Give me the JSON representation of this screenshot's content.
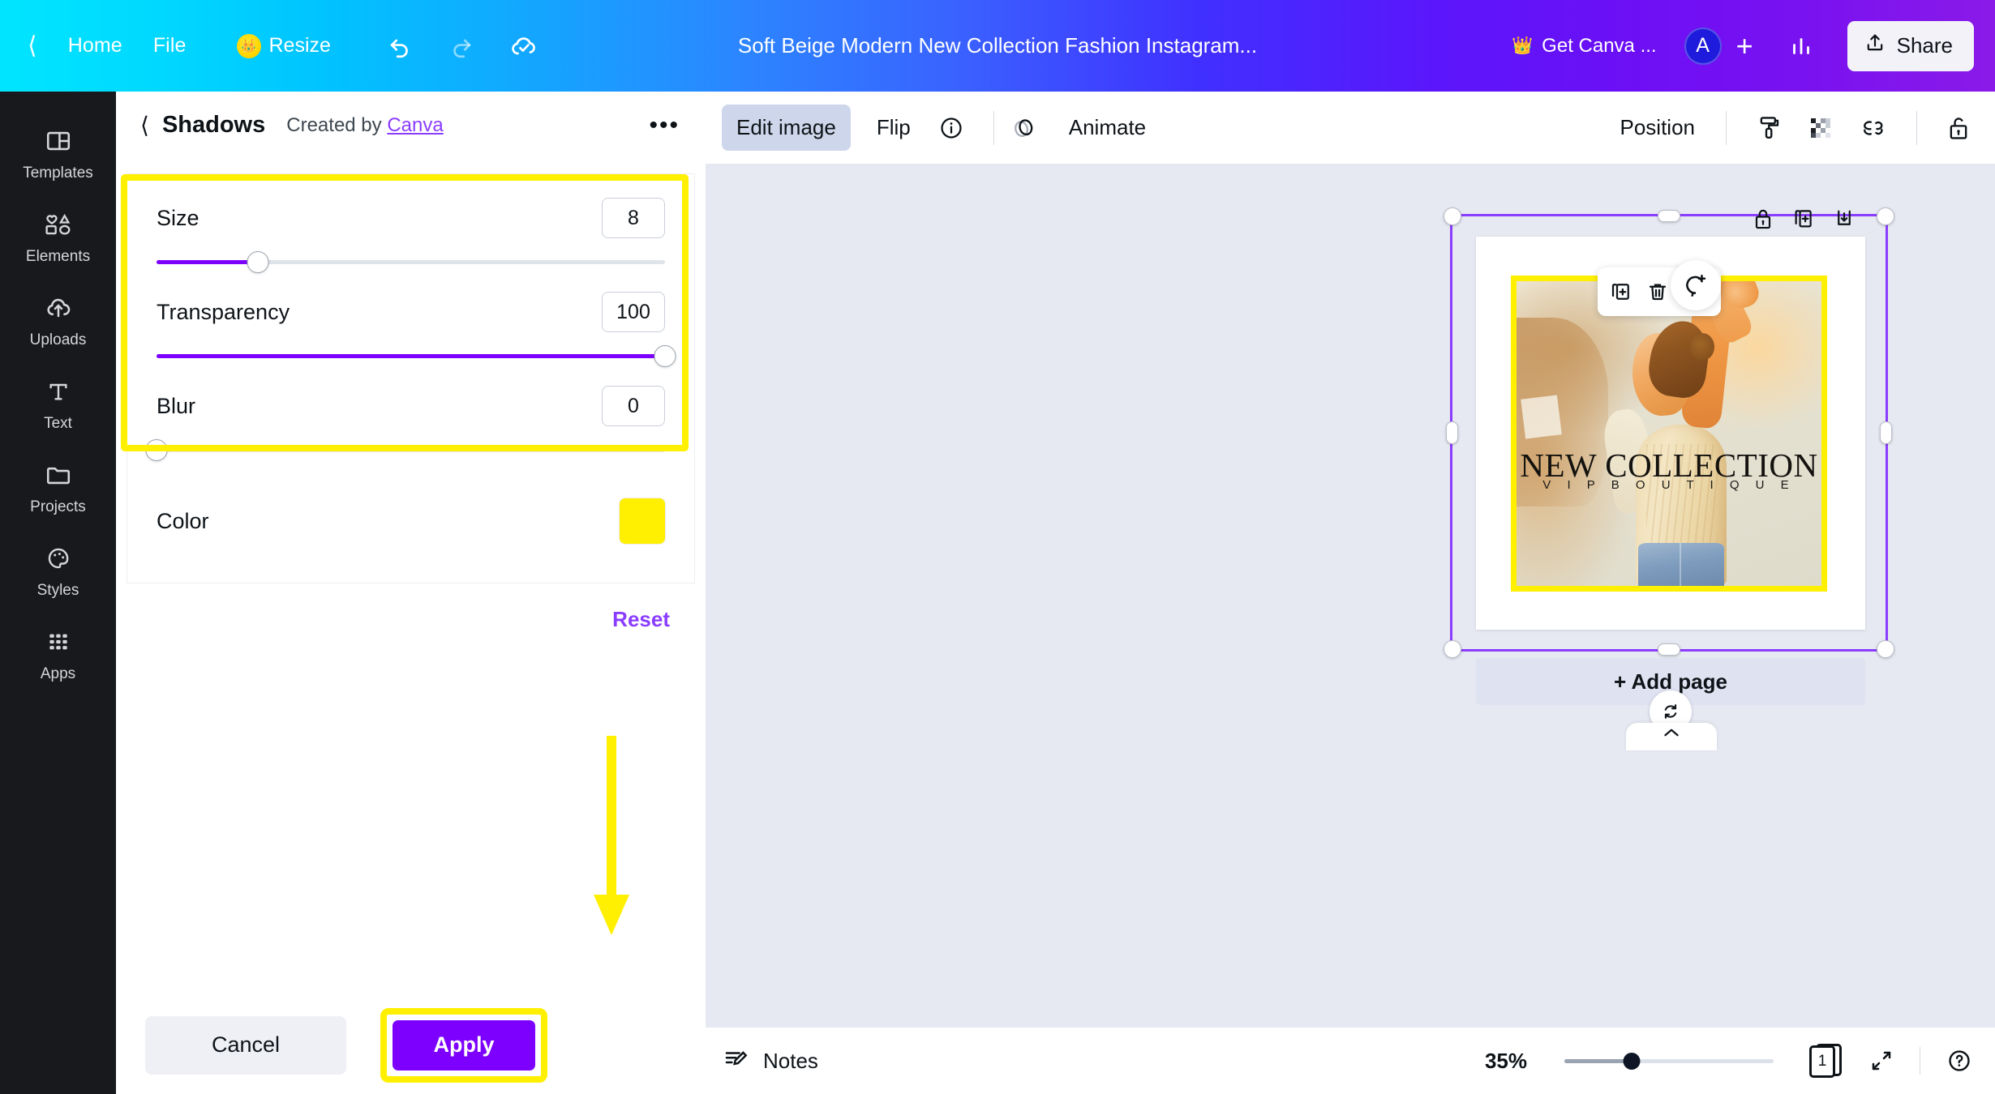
{
  "topbar": {
    "back_icon": "chevron-left-icon",
    "home_label": "Home",
    "file_label": "File",
    "resize_label": "Resize",
    "resize_icon": "crown-badge-icon",
    "undo_icon": "undo-icon",
    "redo_icon": "redo-icon",
    "cloud_saved_icon": "cloud-check-icon",
    "doc_title": "Soft Beige Modern New Collection Fashion Instagram...",
    "get_canva_label": "Get Canva ...",
    "get_canva_icon": "crown-icon",
    "avatar_initial": "A",
    "add_member_icon": "plus-icon",
    "insights_icon": "bar-chart-icon",
    "share_label": "Share",
    "share_icon": "upload-icon"
  },
  "sidebar": {
    "items": [
      {
        "label": "Templates",
        "icon": "templates-icon"
      },
      {
        "label": "Elements",
        "icon": "elements-icon"
      },
      {
        "label": "Uploads",
        "icon": "cloud-upload-icon"
      },
      {
        "label": "Text",
        "icon": "text-icon"
      },
      {
        "label": "Projects",
        "icon": "folder-icon"
      },
      {
        "label": "Styles",
        "icon": "palette-icon"
      },
      {
        "label": "Apps",
        "icon": "apps-grid-icon"
      }
    ]
  },
  "panel": {
    "back_icon": "chevron-left-icon",
    "title": "Shadows",
    "created_by_prefix": "Created by",
    "created_by_link": "Canva",
    "more_icon": "more-options-icon",
    "controls": [
      {
        "label": "Size",
        "value": "8",
        "fill_percent": 20
      },
      {
        "label": "Transparency",
        "value": "100",
        "fill_percent": 100
      },
      {
        "label": "Blur",
        "value": "0",
        "fill_percent": 0
      }
    ],
    "color_label": "Color",
    "color_value": "#FFEF00",
    "reset_label": "Reset",
    "cancel_label": "Cancel",
    "apply_label": "Apply",
    "highlight_color": "#FFEF00",
    "accent_color": "#7D00FF"
  },
  "editor_toolbar": {
    "edit_image_label": "Edit image",
    "flip_label": "Flip",
    "info_icon": "info-icon",
    "animate_label": "Animate",
    "animate_icon": "animate-icon",
    "position_label": "Position",
    "paint_icon": "paint-roller-icon",
    "transparency_icon": "transparency-checker-icon",
    "link_icon": "link-icon",
    "lock_icon": "unlock-icon"
  },
  "canvas": {
    "selection_icons": [
      "lock-icon",
      "duplicate-page-icon",
      "download-page-icon"
    ],
    "float_toolbar_icons": [
      "duplicate-icon",
      "trash-icon",
      "more-options-icon"
    ],
    "comment_icon": "add-comment-icon",
    "add_page_label": "+ Add page",
    "rotate_icon": "rotate-icon",
    "collapse_icon": "chevron-up-icon",
    "design": {
      "title": "NEW COLLECTION",
      "subtitle": "V I P   B O U T I Q U E",
      "border_color": "#FFEF00"
    }
  },
  "bottombar": {
    "notes_label": "Notes",
    "notes_icon": "notes-pencil-icon",
    "zoom_level": "35%",
    "zoom_percent": 35,
    "page_number": "1",
    "pages_icon": "pages-icon",
    "fullscreen_icon": "expand-icon",
    "help_icon": "help-icon"
  }
}
